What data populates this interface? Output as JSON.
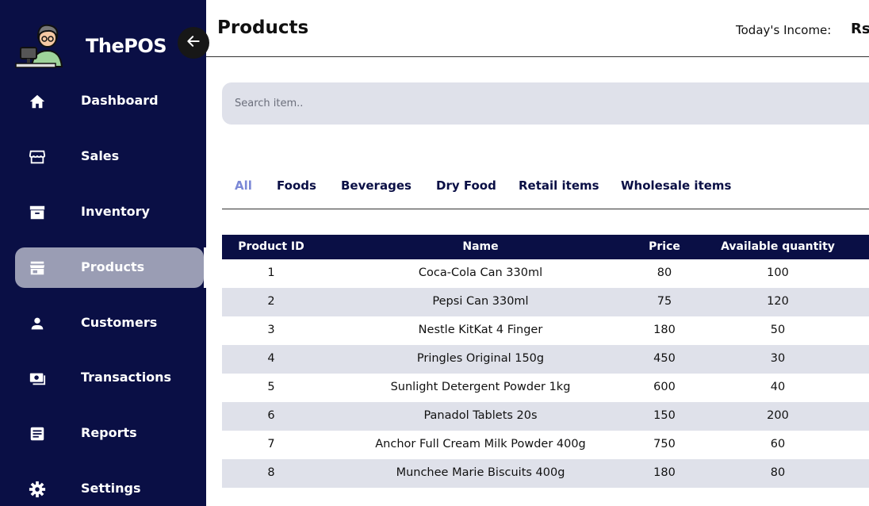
{
  "app": {
    "brand": "ThePOS"
  },
  "sidebar": {
    "items": [
      {
        "label": "Dashboard",
        "icon": "home-icon"
      },
      {
        "label": "Sales",
        "icon": "store-icon"
      },
      {
        "label": "Inventory",
        "icon": "archive-icon"
      },
      {
        "label": "Products",
        "icon": "shop-icon",
        "active": true
      },
      {
        "label": "Customers",
        "icon": "person-icon"
      },
      {
        "label": "Transactions",
        "icon": "cash-icon"
      },
      {
        "label": "Reports",
        "icon": "document-icon"
      },
      {
        "label": "Settings",
        "icon": "gear-icon"
      }
    ]
  },
  "header": {
    "title": "Products",
    "income_label": "Today's Income:",
    "income_currency": "Rs"
  },
  "search": {
    "placeholder": "Search item.."
  },
  "tabs": [
    {
      "label": "All",
      "active": true
    },
    {
      "label": "Foods"
    },
    {
      "label": "Beverages"
    },
    {
      "label": "Dry Food"
    },
    {
      "label": "Retail items"
    },
    {
      "label": "Wholesale items"
    }
  ],
  "table": {
    "columns": [
      "Product ID",
      "Name",
      "Price",
      "Available quantity"
    ],
    "rows": [
      [
        "1",
        "Coca-Cola Can 330ml",
        "80",
        "100"
      ],
      [
        "2",
        "Pepsi Can 330ml",
        "75",
        "120"
      ],
      [
        "3",
        "Nestle KitKat 4 Finger",
        "180",
        "50"
      ],
      [
        "4",
        "Pringles Original 150g",
        "450",
        "30"
      ],
      [
        "5",
        "Sunlight Detergent Powder 1kg",
        "600",
        "40"
      ],
      [
        "6",
        "Panadol Tablets 20s",
        "150",
        "200"
      ],
      [
        "7",
        "Anchor Full Cream Milk Powder 400g",
        "750",
        "60"
      ],
      [
        "8",
        "Munchee Marie Biscuits 400g",
        "180",
        "80"
      ]
    ]
  },
  "colors": {
    "sidebar_bg": "#0a0f45",
    "active_nav_bg": "#9a9db4",
    "active_tab": "#7b88d6",
    "row_alt": "#dfe1ea"
  }
}
